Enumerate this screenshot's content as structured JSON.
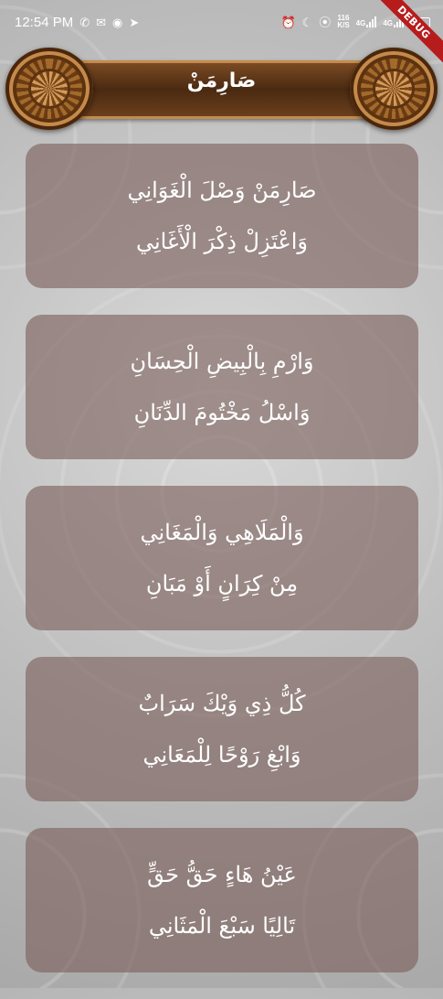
{
  "status_bar": {
    "time": "12:54 PM",
    "net_speed_value": "116",
    "net_speed_unit": "K/S",
    "signal1_label": "4G",
    "signal2_label": "4G",
    "debug_label": "DEBUG",
    "icons": [
      "whatsapp-icon",
      "gmail-icon",
      "app-icon",
      "telegram-icon",
      "alarm-icon",
      "moon-icon",
      "hotspot-icon",
      "battery-icon"
    ]
  },
  "app_bar": {
    "title": "صَارِمَنْ"
  },
  "verses": [
    {
      "line1": "صَارِمَنْ وَصْلَ الْغَوَانِي",
      "line2": "وَاعْتَزِلْ ذِكْرَ الْأَغَانِي"
    },
    {
      "line1": "وَارْمِ بِالْبِيضِ الْحِسَانِ",
      "line2": "وَاسْلُ مَخْتُومَ الدِّنَانِ"
    },
    {
      "line1": "وَالْمَلَاهِي وَالْمَغَانِي",
      "line2": "مِنْ كِرَانٍ أَوْ مَبَانِ"
    },
    {
      "line1": "كُلُّ ذِي وَيْكَ سَرَابٌ",
      "line2": "وَابْغِ رَوْحًا لِلْمَعَانِي"
    },
    {
      "line1": "عَيْنُ هَاءٍ حَقُّ حَقٍّ",
      "line2": "تَالِيًا سَبْعَ الْمَثَانِي"
    }
  ],
  "colors": {
    "card_bg": "#7a605a",
    "app_bar_brown": "#4a2a12",
    "app_bar_border": "#c58b4c",
    "text": "#ffffff"
  }
}
